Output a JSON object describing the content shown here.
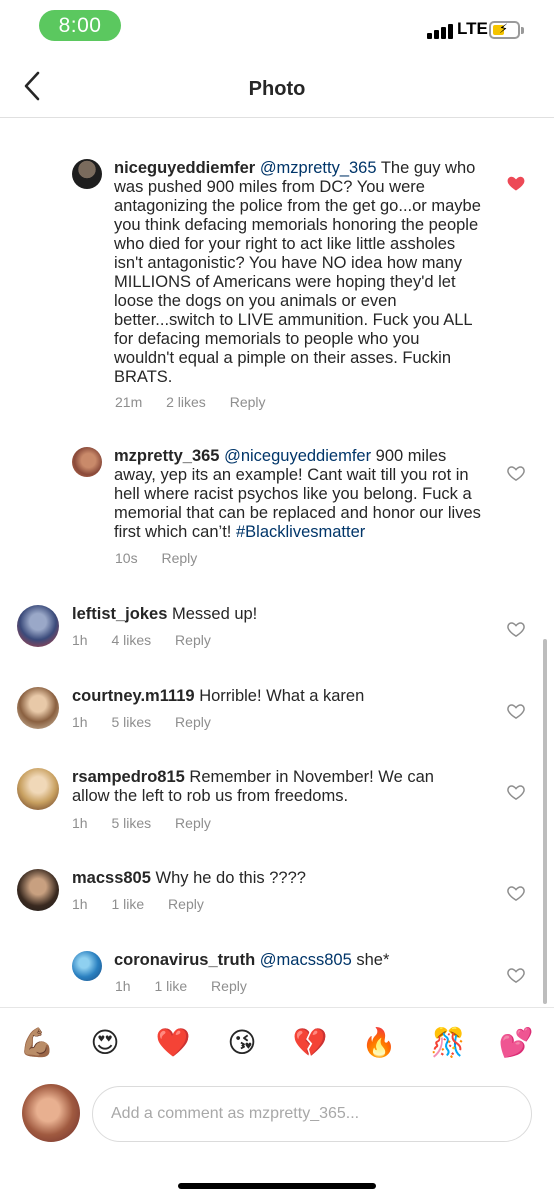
{
  "status_bar": {
    "time": "8:00",
    "network": "LTE",
    "icons": [
      "signal-icon",
      "battery-charging-icon"
    ]
  },
  "nav": {
    "title": "Photo",
    "back_icon": "chevron-left-icon"
  },
  "colors": {
    "time_pill": "#5bc85f",
    "liked_heart": "#ed4956",
    "mention": "#003569",
    "meta_text": "#8e8e8e"
  },
  "comments": [
    {
      "username": "niceguyeddiemfer",
      "mention": "@mzpretty_365",
      "text": "The guy who was pushed 900 miles from DC? You were antagonizing the police from the get go...or maybe you think defacing memorials honoring the people who died for your right to act like little assholes isn't antagonistic? You have NO idea how many MILLIONS of Americans were hoping they'd let loose the dogs on you animals or even better...switch to LIVE ammunition. Fuck you ALL for defacing memorials to people who you wouldn't equal a pimple on their asses. Fuckin BRATS.",
      "time": "21m",
      "likes": "2 likes",
      "reply": "Reply",
      "liked": true,
      "is_reply": true
    },
    {
      "username": "mzpretty_365",
      "mention": "@niceguyeddiemfer",
      "text": "900 miles away, yep its an example! Cant wait till you rot in hell where racist psychos like you belong. Fuck a memorial that can be replaced and honor our lives first which can’t!",
      "hashtag": "#Blacklivesmatter",
      "time": "10s",
      "likes": "",
      "reply": "Reply",
      "liked": false,
      "is_reply": true
    },
    {
      "username": "leftist_jokes",
      "text": "Messed up!",
      "time": "1h",
      "likes": "4 likes",
      "reply": "Reply",
      "liked": false,
      "is_reply": false
    },
    {
      "username": "courtney.m1119",
      "text": "Horrible! What a karen",
      "time": "1h",
      "likes": "5 likes",
      "reply": "Reply",
      "liked": false,
      "is_reply": false
    },
    {
      "username": "rsampedro815",
      "text": "Remember in November!  We can allow the left to rob us from freedoms.",
      "time": "1h",
      "likes": "5 likes",
      "reply": "Reply",
      "liked": false,
      "is_reply": false
    },
    {
      "username": "macss805",
      "text": "Why he do this ????",
      "time": "1h",
      "likes": "1 like",
      "reply": "Reply",
      "liked": false,
      "is_reply": false
    },
    {
      "username": "coronavirus_truth",
      "mention": "@macss805",
      "text": "she*",
      "time": "1h",
      "likes": "1 like",
      "reply": "Reply",
      "liked": false,
      "is_reply": true
    }
  ],
  "emoji_bar": [
    "💪🏽",
    "😍",
    "❤️",
    "😘",
    "💔",
    "🔥",
    "🎊",
    "💕"
  ],
  "comment_input": {
    "placeholder": "Add a comment as mzpretty_365..."
  }
}
